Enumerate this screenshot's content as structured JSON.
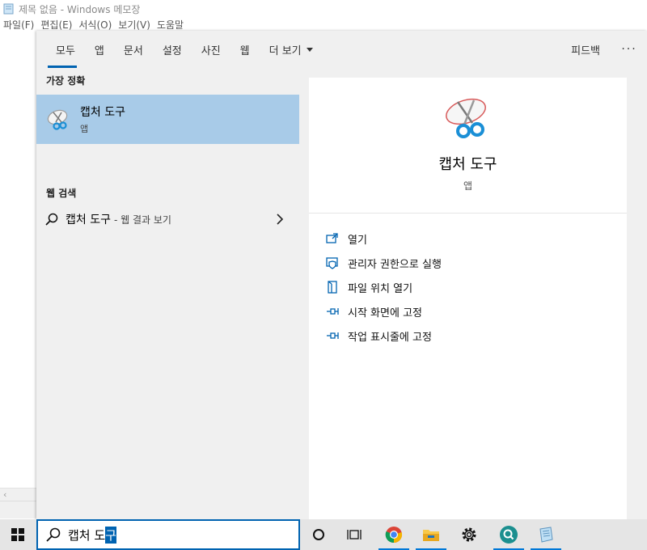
{
  "notepad": {
    "title": "제목 없음 - Windows 메모장",
    "menu": [
      "파일(F)",
      "편집(E)",
      "서식(O)",
      "보기(V)",
      "도움말"
    ]
  },
  "panel": {
    "tabs": [
      {
        "label": "모두",
        "icon": ""
      },
      {
        "label": "앱",
        "icon": ""
      },
      {
        "label": "문서",
        "icon": ""
      },
      {
        "label": "설정",
        "icon": ""
      },
      {
        "label": "사진",
        "icon": ""
      },
      {
        "label": "웹",
        "icon": ""
      },
      {
        "label": "더 보기",
        "icon": "chevron-down-icon"
      }
    ],
    "active_tab": "모두",
    "feedback": "피드백",
    "more": "···"
  },
  "results": {
    "best_match_header": "가장 정확",
    "best_match": {
      "name": "캡처 도구",
      "type": "앱",
      "icon": "snipping-tool-icon"
    },
    "web_header": "웹 검색",
    "web_item": {
      "query": "캡처 도구",
      "suffix": "- 웹 결과 보기"
    }
  },
  "detail": {
    "name": "캡처 도구",
    "type": "앱",
    "actions": [
      {
        "label": "열기",
        "icon": "open-icon"
      },
      {
        "label": "관리자 권한으로 실행",
        "icon": "admin-shield-icon"
      },
      {
        "label": "파일 위치 열기",
        "icon": "file-location-icon"
      },
      {
        "label": "시작 화면에 고정",
        "icon": "pin-icon"
      },
      {
        "label": "작업 표시줄에 고정",
        "icon": "pin-icon"
      }
    ]
  },
  "taskbar": {
    "search_text": "캡처 도",
    "search_selected": "구",
    "icons": [
      "windows-start-icon",
      "cortana-icon",
      "task-view-icon",
      "chrome-icon",
      "file-explorer-icon",
      "settings-icon",
      "search-app-icon",
      "notepad-icon"
    ]
  },
  "colors": {
    "accent": "#0063b1",
    "selected_bg": "#a8cbe8",
    "panel_bg": "#f0f0f0"
  }
}
